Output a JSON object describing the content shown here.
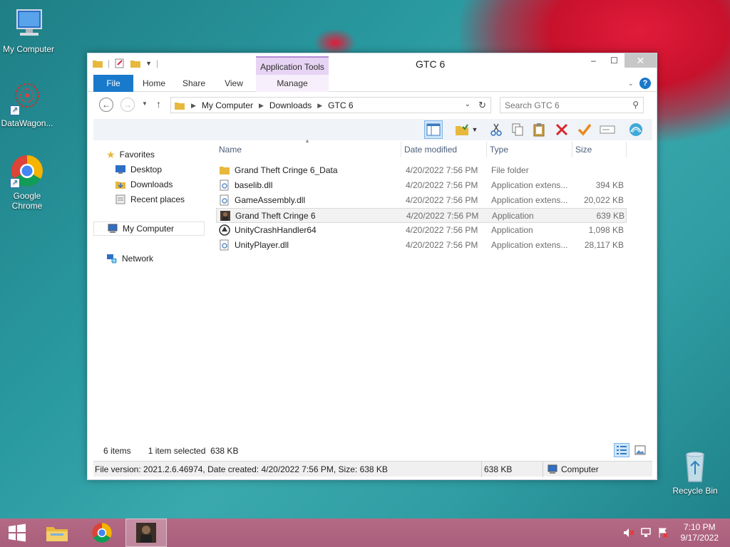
{
  "desktop": {
    "icons": [
      {
        "label": "My Computer"
      },
      {
        "label": "DataWagon..."
      },
      {
        "label": "Google Chrome"
      },
      {
        "label": "Recycle Bin"
      }
    ]
  },
  "window": {
    "title": "GTC 6",
    "context_tab": "Application Tools",
    "ribbon_tabs": [
      "File",
      "Home",
      "Share",
      "View",
      "Manage"
    ],
    "controls": {
      "minimize": "–",
      "maximize": "☐",
      "close": "✕"
    },
    "address": {
      "crumbs": [
        "My Computer",
        "Downloads",
        "GTC 6"
      ]
    },
    "search": {
      "placeholder": "Search GTC 6"
    },
    "nav_pane": {
      "favorites": "Favorites",
      "favorites_items": [
        "Desktop",
        "Downloads",
        "Recent places"
      ],
      "computer": "My Computer",
      "network": "Network"
    },
    "columns": {
      "name": "Name",
      "date": "Date modified",
      "type": "Type",
      "size": "Size"
    },
    "files": [
      {
        "name": "Grand Theft Cringe 6_Data",
        "date": "4/20/2022 7:56 PM",
        "type": "File folder",
        "size": "",
        "icon": "folder-icon"
      },
      {
        "name": "baselib.dll",
        "date": "4/20/2022 7:56 PM",
        "type": "Application extens...",
        "size": "394 KB",
        "icon": "dll-icon"
      },
      {
        "name": "GameAssembly.dll",
        "date": "4/20/2022 7:56 PM",
        "type": "Application extens...",
        "size": "20,022 KB",
        "icon": "dll-icon"
      },
      {
        "name": "Grand Theft Cringe 6",
        "date": "4/20/2022 7:56 PM",
        "type": "Application",
        "size": "639 KB",
        "icon": "app-icon"
      },
      {
        "name": "UnityCrashHandler64",
        "date": "4/20/2022 7:56 PM",
        "type": "Application",
        "size": "1,098 KB",
        "icon": "unity-icon"
      },
      {
        "name": "UnityPlayer.dll",
        "date": "4/20/2022 7:56 PM",
        "type": "Application extens...",
        "size": "28,117 KB",
        "icon": "dll-icon"
      }
    ],
    "status": {
      "items": "6 items",
      "selected": "1 item selected",
      "selected_size": "638 KB"
    },
    "details": {
      "info": "File version: 2021.2.6.46974, Date created: 4/20/2022 7:56 PM, Size: 638 KB",
      "size": "638 KB",
      "location": "Computer"
    }
  },
  "taskbar": {
    "time": "7:10 PM",
    "date": "9/17/2022"
  },
  "colors": {
    "accent": "#1979ca",
    "taskbar": "#a95f7b",
    "context_tab": "#e7d4f4"
  }
}
